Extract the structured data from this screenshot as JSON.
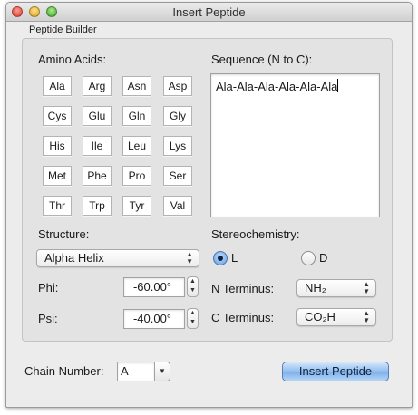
{
  "window": {
    "title": "Insert Peptide"
  },
  "builder": {
    "group_label": "Peptide Builder",
    "amino_acids_label": "Amino Acids:",
    "amino_acids": [
      "Ala",
      "Arg",
      "Asn",
      "Asp",
      "Cys",
      "Glu",
      "Gln",
      "Gly",
      "His",
      "Ile",
      "Leu",
      "Lys",
      "Met",
      "Phe",
      "Pro",
      "Ser",
      "Thr",
      "Trp",
      "Tyr",
      "Val"
    ],
    "sequence_label": "Sequence (N to C):",
    "sequence_value": "Ala-Ala-Ala-Ala-Ala-Ala",
    "structure_label": "Structure:",
    "structure_value": "Alpha Helix",
    "phi_label": "Phi:",
    "phi_value": "-60.00°",
    "psi_label": "Psi:",
    "psi_value": "-40.00°",
    "stereo_label": "Stereochemistry:",
    "stereo_options": [
      "L",
      "D"
    ],
    "stereo_selected": "L",
    "n_terminus_label": "N Terminus:",
    "n_terminus_value": "NH₂",
    "c_terminus_label": "C Terminus:",
    "c_terminus_value": "CO₂H"
  },
  "footer": {
    "chain_label": "Chain Number:",
    "chain_value": "A",
    "insert_button": "Insert Peptide"
  },
  "colors": {
    "accent": "#7aaee9",
    "window_bg": "#ececec"
  },
  "icons": {
    "stepper": "stepper-arrows-icon",
    "popup": "popup-arrows-icon",
    "combo": "chevron-down-icon"
  }
}
